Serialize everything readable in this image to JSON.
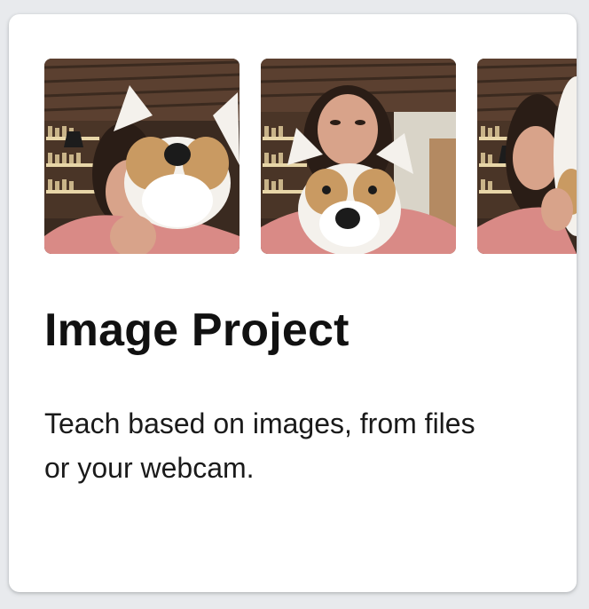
{
  "card": {
    "title": "Image Project",
    "description": "Teach based on images, from files or your webcam.",
    "thumbnails": [
      {
        "subject": "webcam-sample-image"
      },
      {
        "subject": "webcam-sample-image"
      },
      {
        "subject": "webcam-sample-image"
      }
    ]
  },
  "colors": {
    "page_background": "#e8eaed",
    "card_background": "#ffffff",
    "title_text": "#111111",
    "body_text": "#1a1a1a",
    "shelf_wood": "#5b4030",
    "shirt_pink": "#d98a86",
    "toy_white": "#f4f1ec",
    "toy_tan": "#c99a62"
  }
}
